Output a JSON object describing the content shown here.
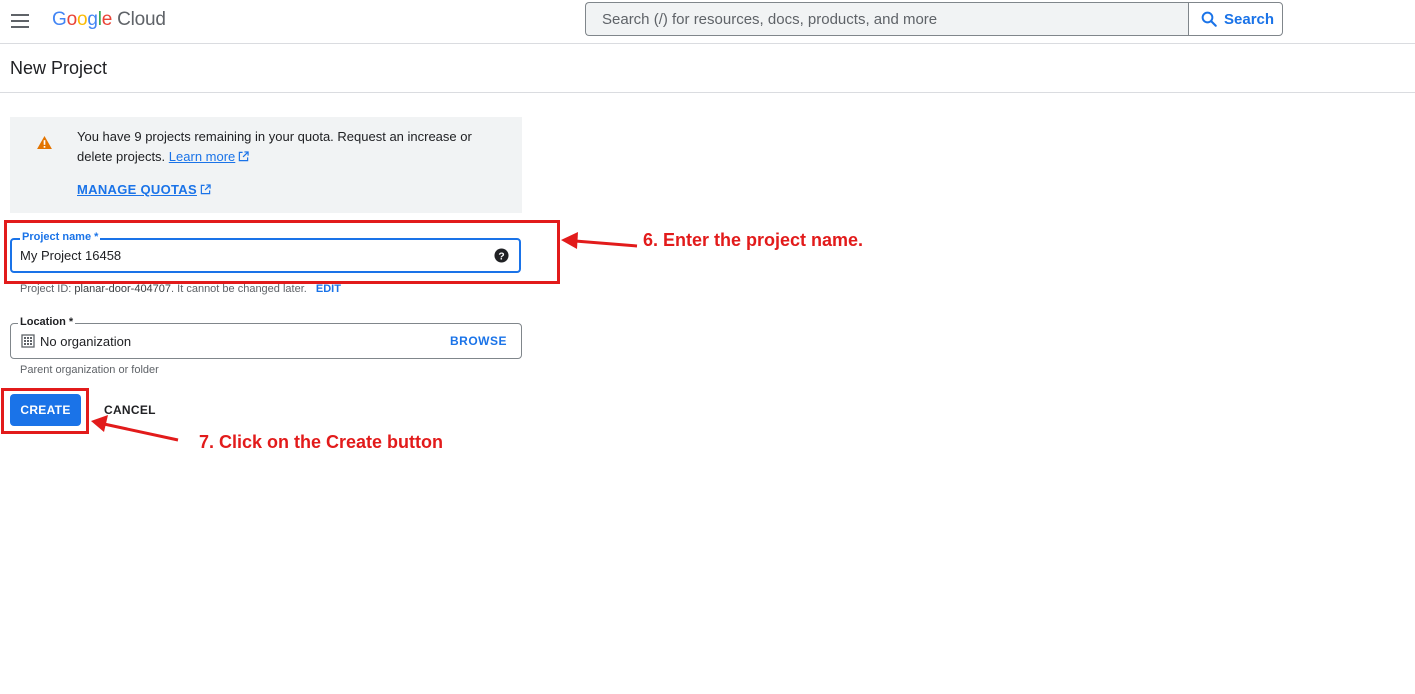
{
  "header": {
    "logo_google": "Google",
    "logo_cloud": "Cloud",
    "search_placeholder": "Search (/) for resources, docs, products, and more",
    "search_button_label": "Search"
  },
  "page": {
    "title": "New Project"
  },
  "notice": {
    "text": "You have 9 projects remaining in your quota. Request an increase or delete projects.",
    "learn_more_label": "Learn more",
    "manage_quotas_label": "MANAGE QUOTAS"
  },
  "form": {
    "project_name_label": "Project name *",
    "project_name_value": "My Project 16458",
    "project_id_prefix": "Project ID: ",
    "project_id_value": "planar-door-404707",
    "project_id_suffix": ". It cannot be changed later.",
    "edit_label": "EDIT",
    "location_label": "Location *",
    "location_value": "No organization",
    "browse_label": "BROWSE",
    "location_hint": "Parent organization or folder",
    "create_label": "CREATE",
    "cancel_label": "CANCEL"
  },
  "annotations": {
    "step6": "6. Enter the project name.",
    "step7": "7. Click on the Create button"
  },
  "colors": {
    "accent": "#1a73e8",
    "annotation": "#e21b1b",
    "warning": "#e37400",
    "notice_bg": "#f1f3f4"
  },
  "icons": {
    "menu": "hamburger-menu-icon",
    "search": "search-icon",
    "warning": "warning-icon",
    "external": "external-link-icon",
    "help": "help-icon",
    "building": "building-icon"
  }
}
